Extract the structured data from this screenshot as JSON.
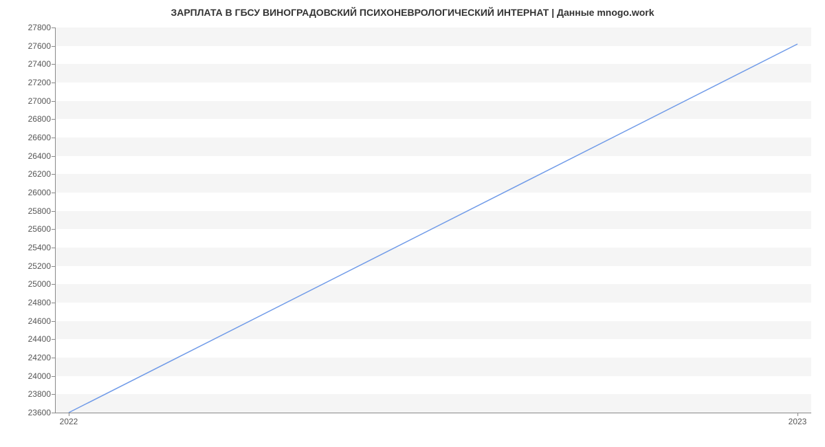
{
  "chart_data": {
    "type": "line",
    "title": "ЗАРПЛАТА В ГБСУ ВИНОГРАДОВСКИЙ ПСИХОНЕВРОЛОГИЧЕСКИЙ ИНТЕРНАТ | Данные mnogo.work",
    "xlabel": "",
    "ylabel": "",
    "x_categories": [
      "2022",
      "2023"
    ],
    "series": [
      {
        "name": "salary",
        "values": [
          23600,
          27620
        ]
      }
    ],
    "y_ticks": [
      23600,
      23800,
      24000,
      24200,
      24400,
      24600,
      24800,
      25000,
      25200,
      25400,
      25600,
      25800,
      26000,
      26200,
      26400,
      26600,
      26800,
      27000,
      27200,
      27400,
      27600,
      27800
    ],
    "ylim": [
      23600,
      27800
    ],
    "line_color": "#6f9ae8"
  }
}
